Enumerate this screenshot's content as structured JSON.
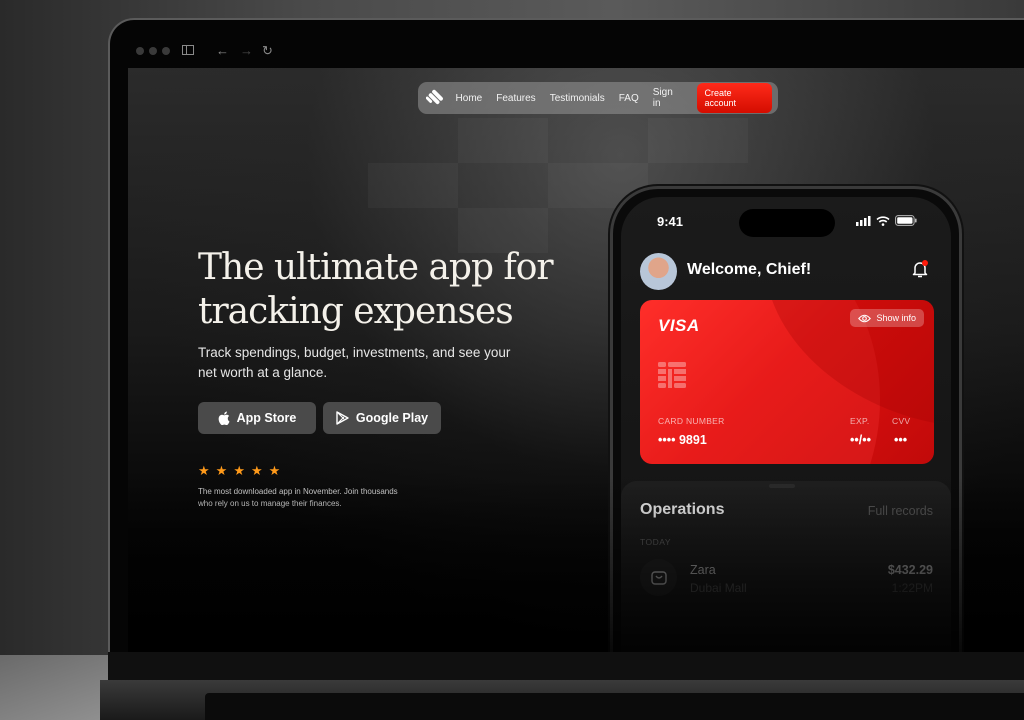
{
  "browser": {
    "traffic_lights": [
      "close",
      "minimize",
      "maximize"
    ],
    "icons": [
      "sidebar-icon",
      "back-icon",
      "forward-icon",
      "reload-icon"
    ]
  },
  "nav": {
    "logo": "brand-logo",
    "links": [
      "Home",
      "Features",
      "Testimonials",
      "FAQ",
      "Sign in"
    ],
    "cta": "Create account"
  },
  "hero": {
    "title_line1": "The ultimate app for",
    "title_line2": "tracking expenses",
    "subtitle": "Track spendings, budget, investments, and see your net worth at a glance.",
    "app_store": "App Store",
    "google_play": "Google Play",
    "rating_stars": 5,
    "rating_text": "The most downloaded app in November. Join thousands who rely on us to manage their finances."
  },
  "phone": {
    "time": "9:41",
    "greeting": "Welcome, Chief!",
    "card": {
      "brand": "VISA",
      "show_info": "Show info",
      "number_label": "CARD NUMBER",
      "number_value": "•••• 9891",
      "exp_label": "EXP.",
      "exp_value": "••/••",
      "cvv_label": "CVV",
      "cvv_value": "•••"
    },
    "operations": {
      "title": "Operations",
      "full_records": "Full records",
      "day": "TODAY",
      "items": [
        {
          "name": "Zara",
          "place": "Dubai Mall",
          "amount": "$432.29",
          "time": "1:22PM"
        }
      ]
    }
  },
  "colors": {
    "accent": "#e5120c",
    "star": "#ff9a1a"
  }
}
